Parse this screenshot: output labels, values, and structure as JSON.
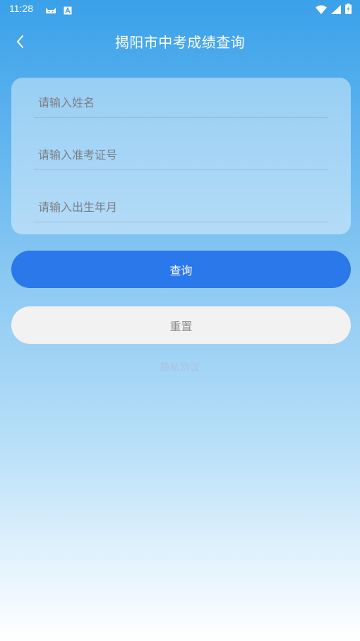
{
  "status_bar": {
    "time": "11:28",
    "left_icons": [
      "cat-icon",
      "a-box-icon"
    ],
    "right_icons": [
      "wifi-icon",
      "signal-icon",
      "battery-icon"
    ]
  },
  "header": {
    "title": "揭阳市中考成绩查询",
    "back_icon": "chevron-left-icon"
  },
  "form": {
    "name_placeholder": "请输入姓名",
    "name_value": "",
    "exam_id_placeholder": "请输入准考证号",
    "exam_id_value": "",
    "birth_placeholder": "请输入出生年月",
    "birth_value": ""
  },
  "buttons": {
    "query_label": "查询",
    "reset_label": "重置"
  },
  "links": {
    "privacy_label": "隐私协议"
  },
  "colors": {
    "primary": "#2b78ea",
    "reset_bg": "#f2f2f2",
    "gradient_top": "#3aa1e9",
    "gradient_bottom": "#ffffff"
  }
}
